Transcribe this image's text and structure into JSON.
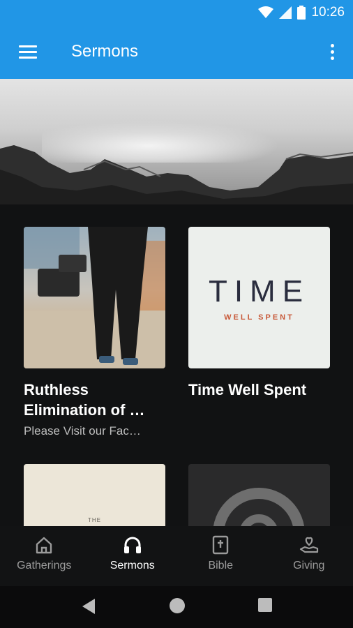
{
  "status_bar": {
    "time": "10:26",
    "icons": [
      "wifi-icon",
      "cell-signal-icon",
      "battery-icon"
    ]
  },
  "app_bar": {
    "title": "Sermons",
    "menu_icon": "hamburger-menu-icon",
    "overflow_icon": "more-vert-icon",
    "background": "#2196e6"
  },
  "sermons": [
    {
      "title_line1": "Ruthless",
      "title_line2": "Elimination of …",
      "subtitle": "Please Visit our Fac…"
    },
    {
      "title_line1": "Time Well Spent",
      "logo_word": "TIME",
      "logo_sub": "WELL SPENT"
    },
    {
      "thumb_text": "THE"
    },
    {}
  ],
  "bottom_nav": {
    "items": [
      {
        "label": "Gatherings",
        "icon": "home-icon",
        "active": false
      },
      {
        "label": "Sermons",
        "icon": "headphones-icon",
        "active": true
      },
      {
        "label": "Bible",
        "icon": "bible-icon",
        "active": false
      },
      {
        "label": "Giving",
        "icon": "giving-hand-heart-icon",
        "active": false
      }
    ]
  },
  "system_nav": {
    "icons": [
      "back-icon",
      "home-circle-icon",
      "recents-icon"
    ]
  }
}
